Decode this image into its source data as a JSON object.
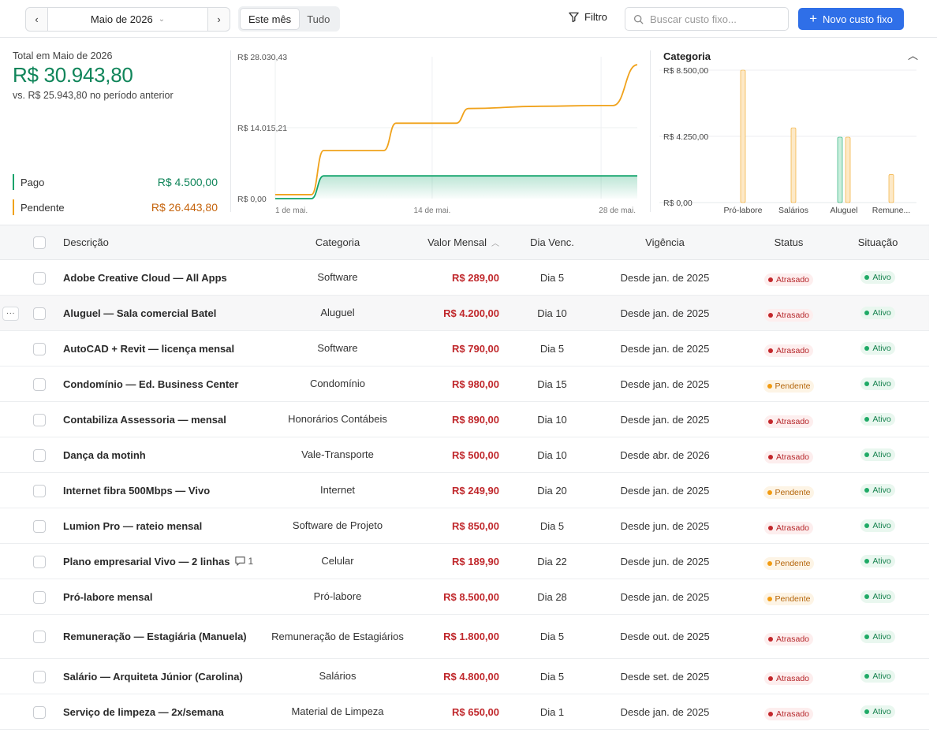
{
  "toolbar": {
    "prev_label": "‹",
    "month_label": "Maio de 2026",
    "next_label": "›",
    "segments": [
      "Este mês",
      "Tudo"
    ],
    "filter_label": "Filtro",
    "search_placeholder": "Buscar custo fixo...",
    "new_button_label": "Novo custo fixo",
    "accent_color": "#2f6fe8"
  },
  "summary": {
    "total_label": "Total em Maio de 2026",
    "total_value": "R$ 30.943,80",
    "previous_text": "vs. R$ 25.943,80 no período anterior",
    "paid_label": "Pago",
    "paid_value": "R$ 4.500,00",
    "pending_label": "Pendente",
    "pending_value": "R$ 26.443,80",
    "paid_color": "#10a36a",
    "pending_color": "#f0a21b"
  },
  "chart_data": [
    {
      "type": "line",
      "y_tick_labels": [
        "R$ 28.030,43",
        "R$ 14.015,21",
        "R$ 0,00"
      ],
      "x_tick_labels": [
        "1 de mai.",
        "14 de mai.",
        "28 de mai."
      ],
      "ylim": [
        0,
        28030.43
      ],
      "xlim": [
        1,
        31
      ],
      "series": [
        {
          "name": "Pendente",
          "color": "#f0a21b",
          "x": [
            1,
            4,
            5,
            10,
            11,
            16,
            17,
            23,
            28,
            29,
            31
          ],
          "y": [
            790,
            790,
            9500,
            9500,
            14900,
            14900,
            17800,
            18250,
            18400,
            18400,
            26443.8
          ]
        },
        {
          "name": "Pago",
          "color": "#10a36a",
          "x": [
            1,
            4,
            5,
            31
          ],
          "y": [
            0,
            0,
            4500,
            4500
          ]
        }
      ]
    },
    {
      "type": "bar",
      "title": "Categoria",
      "y_tick_labels": [
        "R$ 8.500,00",
        "R$ 4.250,00",
        "R$ 0,00"
      ],
      "ylim": [
        0,
        8500
      ],
      "categories": [
        "Pró-labore",
        "Salários",
        "Aluguel",
        "Remune..."
      ],
      "series": [
        {
          "name": "Pago",
          "color": "#10a36a",
          "values": [
            0,
            0,
            4200,
            0
          ]
        },
        {
          "name": "Pendente",
          "color": "#f0a21b",
          "values": [
            8500,
            4800,
            4200,
            1800
          ]
        }
      ]
    }
  ],
  "table": {
    "headers": {
      "descricao": "Descrição",
      "categoria": "Categoria",
      "valor": "Valor Mensal",
      "dia": "Dia Venc.",
      "vigencia": "Vigência",
      "status": "Status",
      "situacao": "Situação"
    },
    "rows": [
      {
        "descricao": "Adobe Creative Cloud — All Apps",
        "categoria": "Software",
        "valor": "R$ 289,00",
        "dia": "Dia 5",
        "vigencia": "Desde jan. de 2025",
        "status": "Atrasado",
        "situacao": "Ativo"
      },
      {
        "descricao": "Aluguel — Sala comercial Batel",
        "categoria": "Aluguel",
        "valor": "R$ 4.200,00",
        "dia": "Dia 10",
        "vigencia": "Desde jan. de 2025",
        "status": "Atrasado",
        "situacao": "Ativo"
      },
      {
        "descricao": "AutoCAD + Revit — licença mensal",
        "categoria": "Software",
        "valor": "R$ 790,00",
        "dia": "Dia 5",
        "vigencia": "Desde jan. de 2025",
        "status": "Atrasado",
        "situacao": "Ativo"
      },
      {
        "descricao": "Condomínio — Ed. Business Center",
        "categoria": "Condomínio",
        "valor": "R$ 980,00",
        "dia": "Dia 15",
        "vigencia": "Desde jan. de 2025",
        "status": "Pendente",
        "situacao": "Ativo"
      },
      {
        "descricao": "Contabiliza Assessoria — mensal",
        "categoria": "Honorários Contábeis",
        "valor": "R$ 890,00",
        "dia": "Dia 10",
        "vigencia": "Desde jan. de 2025",
        "status": "Atrasado",
        "situacao": "Ativo"
      },
      {
        "descricao": "Dança da motinh",
        "categoria": "Vale-Transporte",
        "valor": "R$ 500,00",
        "dia": "Dia 10",
        "vigencia": "Desde abr. de 2026",
        "status": "Atrasado",
        "situacao": "Ativo"
      },
      {
        "descricao": "Internet fibra 500Mbps — Vivo",
        "categoria": "Internet",
        "valor": "R$ 249,90",
        "dia": "Dia 20",
        "vigencia": "Desde jan. de 2025",
        "status": "Pendente",
        "situacao": "Ativo"
      },
      {
        "descricao": "Lumion Pro — rateio mensal",
        "categoria": "Software de Projeto",
        "valor": "R$ 850,00",
        "dia": "Dia 5",
        "vigencia": "Desde jun. de 2025",
        "status": "Atrasado",
        "situacao": "Ativo"
      },
      {
        "descricao": "Plano empresarial Vivo — 2 linhas",
        "comments": "1",
        "categoria": "Celular",
        "valor": "R$ 189,90",
        "dia": "Dia 22",
        "vigencia": "Desde jun. de 2025",
        "status": "Pendente",
        "situacao": "Ativo"
      },
      {
        "descricao": "Pró-labore mensal",
        "categoria": "Pró-labore",
        "valor": "R$ 8.500,00",
        "dia": "Dia 28",
        "vigencia": "Desde jan. de 2025",
        "status": "Pendente",
        "situacao": "Ativo"
      },
      {
        "descricao": "Remuneração — Estagiária (Manuela)",
        "categoria": "Remuneração de Estagiários",
        "valor": "R$ 1.800,00",
        "dia": "Dia 5",
        "vigencia": "Desde out. de 2025",
        "status": "Atrasado",
        "situacao": "Ativo"
      },
      {
        "descricao": "Salário — Arquiteta Júnior (Carolina)",
        "categoria": "Salários",
        "valor": "R$ 4.800,00",
        "dia": "Dia 5",
        "vigencia": "Desde set. de 2025",
        "status": "Atrasado",
        "situacao": "Ativo"
      },
      {
        "descricao": "Serviço de limpeza — 2x/semana",
        "categoria": "Material de Limpeza",
        "valor": "R$ 650,00",
        "dia": "Dia 1",
        "vigencia": "Desde jan. de 2025",
        "status": "Atrasado",
        "situacao": "Ativo"
      }
    ]
  }
}
